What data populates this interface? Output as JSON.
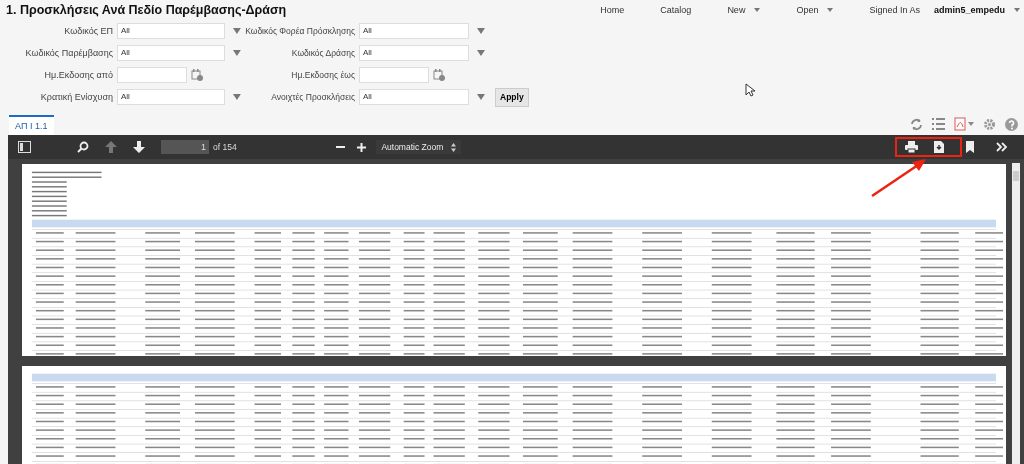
{
  "title": "1. Προσκλήσεις Ανά Πεδίο Παρέμβασης-Δράση",
  "nav": [
    {
      "label": "Home",
      "menu": false
    },
    {
      "label": "Catalog",
      "menu": false
    },
    {
      "label": "New",
      "menu": true
    },
    {
      "label": "Open",
      "menu": true
    }
  ],
  "user": {
    "caption": "Signed In As",
    "name": "admin5_empedu"
  },
  "filters": [
    {
      "label": "Κωδικός ΕΠ",
      "kind": "select",
      "value": "All"
    },
    {
      "label": "Κωδικός Φορέα Πρόσκλησης",
      "kind": "select",
      "value": "All"
    },
    {
      "label": "Κωδικός Παρέμβασης",
      "kind": "select",
      "value": "All"
    },
    {
      "label": "Κωδικός Δράσης",
      "kind": "select",
      "value": "All"
    },
    {
      "label": "Ημ.Εκδοσης από",
      "kind": "date"
    },
    {
      "label": "Ημ.Εκδοσης έως",
      "kind": "date"
    },
    {
      "label": "Κρατική Ενίσχυση",
      "kind": "select",
      "value": "All"
    },
    {
      "label": "Ανοιχτές Προσκλήσεις",
      "kind": "select",
      "value": "All"
    }
  ],
  "apply_button": "Apply",
  "tabs": [
    {
      "label": "ΑΠ Ι 1.1",
      "selected": true
    }
  ],
  "viewer": {
    "page_number": "1",
    "page_count": "of 154",
    "zoom": "Automatic Zoom"
  },
  "annotation": {
    "highlight": true
  }
}
